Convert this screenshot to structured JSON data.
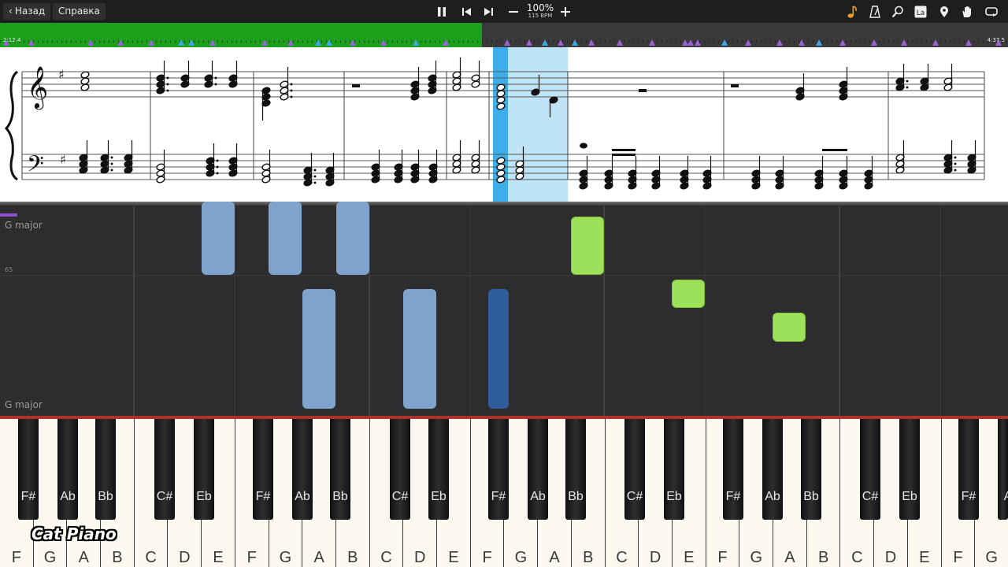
{
  "toolbar": {
    "back_label": "Назад",
    "help_label": "Справка",
    "speed_percent": "100%",
    "bpm": "115 BPM"
  },
  "progress": {
    "elapsed": "2:12.4",
    "total": "4:37.5",
    "fraction": 0.478
  },
  "score": {
    "key_signature": "G major",
    "current_measure": 6
  },
  "roll": {
    "key_label_top": "G major",
    "octave_label": "65",
    "key_label_bottom": "G major",
    "colors": {
      "past_note": "#7fa3cc",
      "active_note": "#2f5c9a",
      "right_hand": "#9de05a"
    }
  },
  "keyboard": {
    "white_keys": [
      "F",
      "G",
      "A",
      "B",
      "C",
      "D",
      "E",
      "F",
      "G",
      "A",
      "B",
      "C",
      "D",
      "E",
      "F",
      "G",
      "A",
      "B",
      "C",
      "D",
      "E",
      "F",
      "G",
      "A",
      "B",
      "C",
      "D",
      "E",
      "F",
      "G"
    ],
    "black_keys": [
      "F#",
      "Ab",
      "Bb",
      "C#",
      "Eb",
      "F#",
      "Ab",
      "Bb",
      "C#",
      "Eb",
      "F#",
      "Ab",
      "Bb",
      "C#",
      "Eb",
      "F#",
      "Ab",
      "Bb",
      "C#",
      "Eb",
      "F#",
      "A"
    ]
  },
  "brand": "Cat Piano",
  "colors": {
    "progress_played": "#1aa01a",
    "highlight": "#3daee9",
    "keyboard_accent": "#b0302c"
  }
}
